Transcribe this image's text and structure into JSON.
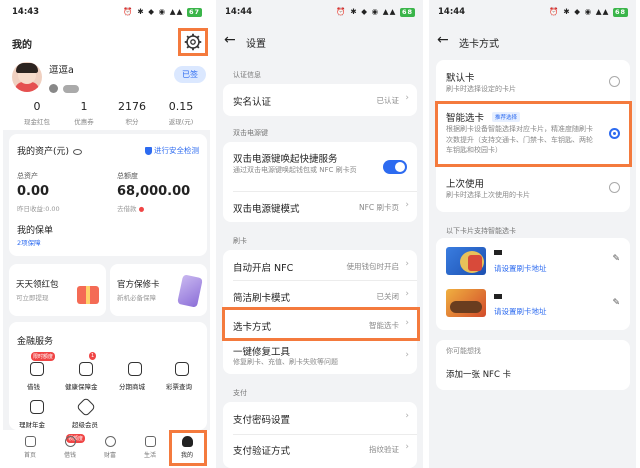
{
  "p1": {
    "time": "14:43",
    "battery": "67",
    "title": "我的",
    "username": "逗逗a",
    "signed": "已签",
    "stats": [
      {
        "n": "0",
        "l": "现金红包"
      },
      {
        "n": "1",
        "l": "优惠券"
      },
      {
        "n": "2176",
        "l": "积分"
      },
      {
        "n": "0.15",
        "l": "返现(元)"
      }
    ],
    "assets": {
      "title": "我的资产(元)",
      "security": "进行安全检测",
      "total_label": "总资产",
      "total": "0.00",
      "yesterday": "昨日收益:0.00",
      "quota_label": "总额度",
      "quota": "68,000.00",
      "quota_sub": "去借款",
      "policy": "我的保单",
      "policy_sub": "2项保障"
    },
    "promo1": {
      "title": "天天领红包",
      "sub": "可立即提现"
    },
    "promo2": {
      "title": "官方保修卡",
      "sub": "新机必备保障"
    },
    "finance": {
      "title": "金融服务",
      "items": [
        "借钱",
        "健康保障金",
        "分期商城",
        "彩票查询",
        "理财年金",
        "超级会员"
      ],
      "badge1": "限时额度",
      "badge2": "1"
    },
    "tabs": [
      "首页",
      "借钱",
      "财富",
      "生活",
      "我的"
    ],
    "tab_badge": "领额度"
  },
  "p2": {
    "time": "14:44",
    "battery": "68",
    "title": "设置",
    "sec1": "认证信息",
    "real_name": "实名认证",
    "real_name_val": "已认证",
    "sec2": "双击电源键",
    "dbl": "双击电源键唤起快捷服务",
    "dbl_sub": "通过双击电源键唤起钱包或 NFC 刷卡页",
    "dbl_mode": "双击电源键模式",
    "dbl_mode_val": "NFC 刷卡页",
    "sec3": "刷卡",
    "auto_nfc": "自动开启 NFC",
    "auto_nfc_val": "使用钱包时开启",
    "quick": "简洁刷卡模式",
    "quick_val": "已关闭",
    "select": "选卡方式",
    "select_val": "智能选卡",
    "repair": "一键修复工具",
    "repair_sub": "修复刷卡、充值、刷卡失败等问题",
    "sec4": "支付",
    "pay_pwd": "支付密码设置",
    "pay_verify": "支付验证方式",
    "pay_verify_val": "指纹验证"
  },
  "p3": {
    "time": "14:44",
    "battery": "68",
    "title": "选卡方式",
    "default": "默认卡",
    "default_sub": "刷卡时选择设定的卡片",
    "smart": "智能选卡",
    "rec": "推荐选择",
    "smart_sub": "根据刷卡设备智能选择对应卡片，精准度随刷卡次数提升（支持交通卡、门禁卡、车钥匙、两轮车钥匙和校园卡）",
    "last": "上次使用",
    "last_sub": "刷卡时选择上次使用的卡片",
    "support": "以下卡片支持智能选卡",
    "link1": "请设置刷卡地址",
    "link2": "请设置刷卡地址",
    "maybe": "你可能想找",
    "add_nfc": "添加一张 NFC 卡"
  }
}
